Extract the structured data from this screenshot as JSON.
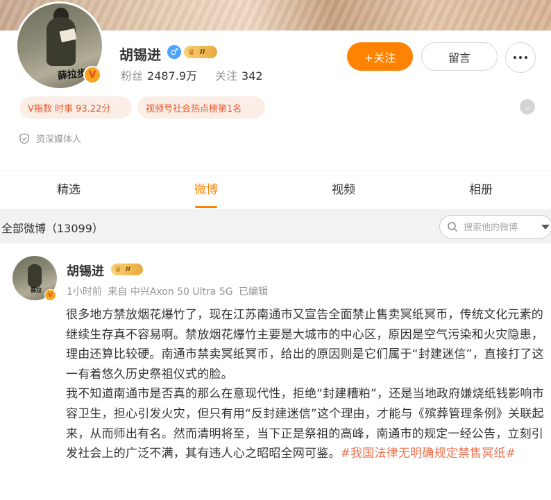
{
  "profile": {
    "name": "胡锡进",
    "avatar_signature": "薛拉步\n190",
    "followers_label": "粉丝",
    "followers_value": "2487.9万",
    "following_label": "关注",
    "following_value": "342",
    "vip_level": "II",
    "follow_button": "+关注",
    "message_button": "留言",
    "tags": [
      "V指数 时事 93.22分",
      "视频号社会热点榜第1名"
    ],
    "identity": "资深媒体人"
  },
  "tabs": [
    {
      "label": "精选",
      "active": false
    },
    {
      "label": "微博",
      "active": true
    },
    {
      "label": "视频",
      "active": false
    },
    {
      "label": "相册",
      "active": false
    }
  ],
  "filter": {
    "title": "全部微博（13099）",
    "search_placeholder": "搜索他的微博"
  },
  "post": {
    "author": "胡锡进",
    "vip_level": "II",
    "time": "1小时前",
    "source": "来自 中兴Axon 50 Ultra 5G",
    "edited": "已编辑",
    "paragraph1": "很多地方禁放烟花爆竹了，现在江苏南通市又宣告全面禁止售卖冥纸冥币，传统文化元素的继续生存真不容易啊。禁放烟花爆竹主要是大城市的中心区，原因是空气污染和火灾隐患，理由还算比较硬。南通市禁卖冥纸冥币，给出的原因则是它们属于“封建迷信”，直接打了这一有着悠久历史祭祖仪式的脸。",
    "paragraph2": "我不知道南通市是否真的那么在意现代性，拒绝“封建糟粕”，还是当地政府嫌烧纸钱影响市容卫生，担心引发火灾，但只有用“反封建迷信”这个理由，才能与《殡葬管理条例》关联起来，从而师出有名。然而清明将至，当下正是祭祖的高峰，南通市的规定一经公告，立刻引发社会上的广泛不满，其有违人心之昭昭全网可鉴。",
    "hashtag": "#我国法律无明确规定禁售冥纸#"
  },
  "colors": {
    "accent": "#ff8200",
    "tag_text": "#e8592d",
    "tag_bg": "#fbeee6",
    "hashtag": "#eb7350"
  },
  "icons": [
    "gender-male-icon",
    "crown-icon",
    "more-dots-icon",
    "chevron-down-icon",
    "shield-icon",
    "search-icon",
    "dropdown-caret-icon",
    "verified-icon"
  ]
}
